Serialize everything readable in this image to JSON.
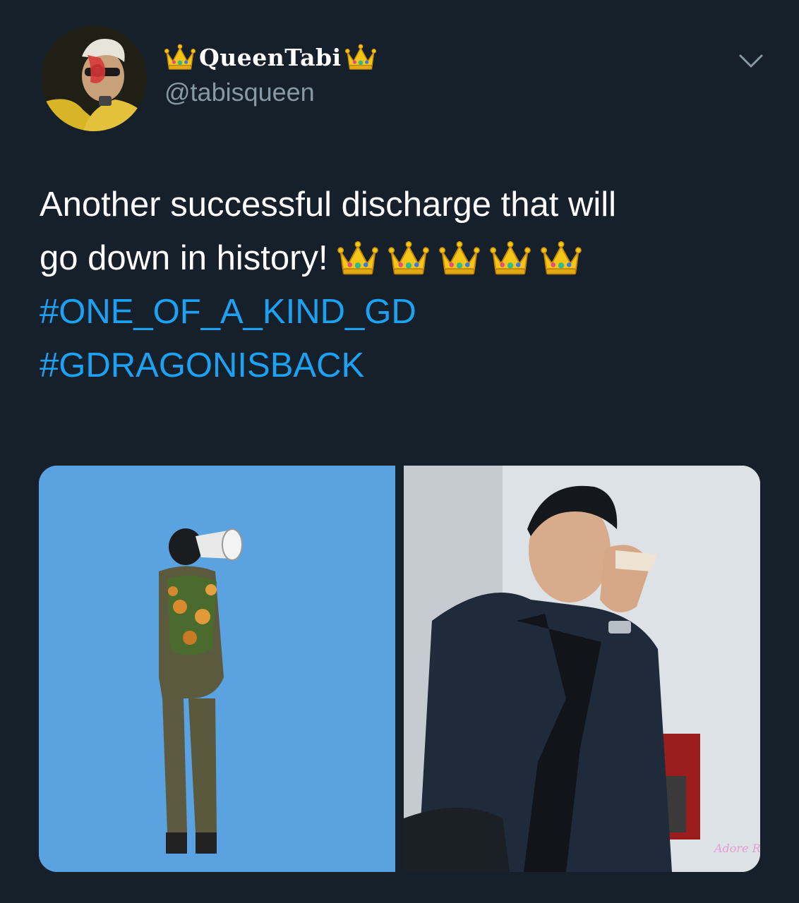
{
  "user": {
    "display_name": "QueenTabi",
    "handle": "@tabisqueen",
    "avatar_icon": "avatar-photo"
  },
  "tweet": {
    "line1": "Another successful discharge that will",
    "line2": "go down in history!",
    "crown_count": 5,
    "hashtag1": "#ONE_OF_A_KIND_GD",
    "hashtag2": "#GDRAGONISBACK"
  },
  "media": {
    "photo_left_icon": "soldier-with-megaphone-photo",
    "photo_right_icon": "man-wiping-tears-photo",
    "watermark": "Adore Ri"
  },
  "colors": {
    "background": "#15202b",
    "hashtag": "#1da1f2",
    "handle": "#8899a6"
  }
}
